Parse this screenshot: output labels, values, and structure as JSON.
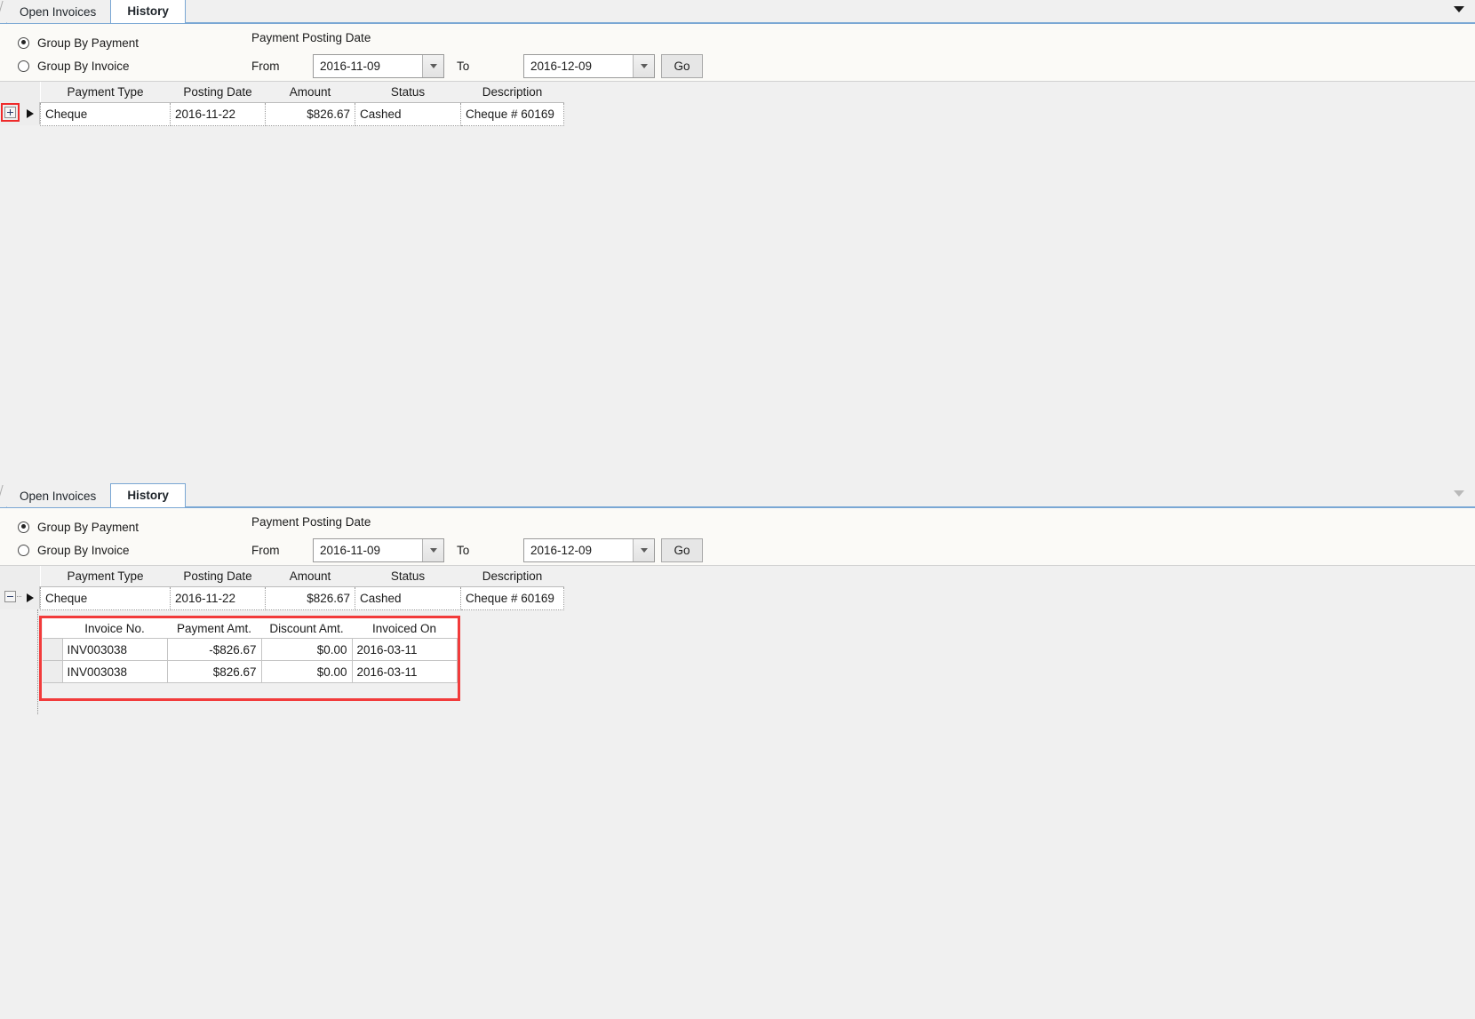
{
  "panels": [
    {
      "id": "top",
      "tabs": [
        {
          "label": "Open Invoices",
          "active": false
        },
        {
          "label": "History",
          "active": true
        }
      ],
      "overflow_icon": "chevron-down-icon",
      "filters": {
        "group_by_payment_label": "Group By Payment",
        "group_by_invoice_label": "Group By Invoice",
        "group_by_selected": "Group By Payment",
        "posting_date_label": "Payment Posting Date",
        "from_label": "From",
        "to_label": "To",
        "from_value": "2016-11-09",
        "to_value": "2016-12-09",
        "go_label": "Go"
      },
      "master_grid": {
        "columns": [
          "Payment Type",
          "Posting Date",
          "Amount",
          "Status",
          "Description"
        ],
        "rows": [
          {
            "expander": "+",
            "cells": [
              "Cheque",
              "2016-11-22",
              "$826.67",
              "Cashed",
              "Cheque # 60169"
            ]
          }
        ]
      },
      "expanded": false,
      "detail_grid": null
    },
    {
      "id": "bottom",
      "tabs": [
        {
          "label": "Open Invoices",
          "active": false
        },
        {
          "label": "History",
          "active": true
        }
      ],
      "overflow_icon": "chevron-down-icon",
      "filters": {
        "group_by_payment_label": "Group By Payment",
        "group_by_invoice_label": "Group By Invoice",
        "group_by_selected": "Group By Payment",
        "posting_date_label": "Payment Posting Date",
        "from_label": "From",
        "to_label": "To",
        "from_value": "2016-11-09",
        "to_value": "2016-12-09",
        "go_label": "Go"
      },
      "master_grid": {
        "columns": [
          "Payment Type",
          "Posting Date",
          "Amount",
          "Status",
          "Description"
        ],
        "rows": [
          {
            "expander": "-",
            "cells": [
              "Cheque",
              "2016-11-22",
              "$826.67",
              "Cashed",
              "Cheque # 60169"
            ]
          }
        ]
      },
      "expanded": true,
      "detail_grid": {
        "columns": [
          "Invoice No.",
          "Payment Amt.",
          "Discount Amt.",
          "Invoiced On"
        ],
        "rows": [
          [
            "INV003038",
            "-$826.67",
            "$0.00",
            "2016-03-11"
          ],
          [
            "INV003038",
            "$826.67",
            "$0.00",
            "2016-03-11"
          ]
        ]
      }
    }
  ],
  "colors": {
    "tab_accent": "#7aa7d4",
    "highlight_red": "#f23b3b",
    "expander_highlight_red": "#ef2b2b",
    "panel_bg": "#f0f0f0",
    "filter_bg": "#fbfaf7"
  }
}
